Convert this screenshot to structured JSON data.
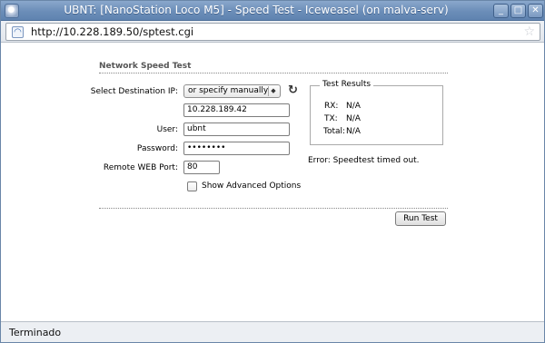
{
  "window": {
    "title": "UBNT: [NanoStation Loco M5] - Speed Test - Iceweasel (on malva-serv)",
    "minimize_glyph": "_",
    "maximize_glyph": "□",
    "close_glyph": "✕"
  },
  "address_bar": {
    "url": "http://10.228.189.50/sptest.cgi",
    "feed_icon": "rss-icon",
    "bookmark_icon": "star-icon"
  },
  "speed_test": {
    "section_title": "Network Speed Test",
    "destination_label": "Select Destination IP:",
    "destination_select_value": "or specify manually",
    "destination_ip": "10.228.189.42",
    "user_label": "User:",
    "user_value": "ubnt",
    "password_label": "Password:",
    "password_value": "••••••••",
    "port_label": "Remote WEB Port:",
    "port_value": "80",
    "advanced_label": "Show Advanced Options",
    "advanced_checked": false,
    "refresh_icon": "refresh-icon",
    "run_button": "Run Test"
  },
  "results": {
    "legend": "Test Results",
    "rx_label": "RX:",
    "rx_value": "N/A",
    "tx_label": "TX:",
    "tx_value": "N/A",
    "total_label": "Total:",
    "total_value": "N/A",
    "error": "Error: Speedtest timed out."
  },
  "status_bar": {
    "text": "Terminado"
  },
  "colors": {
    "titlebar": "#6b8db8",
    "window_border": "#6a86a8",
    "statusbar": "#eceff3"
  }
}
